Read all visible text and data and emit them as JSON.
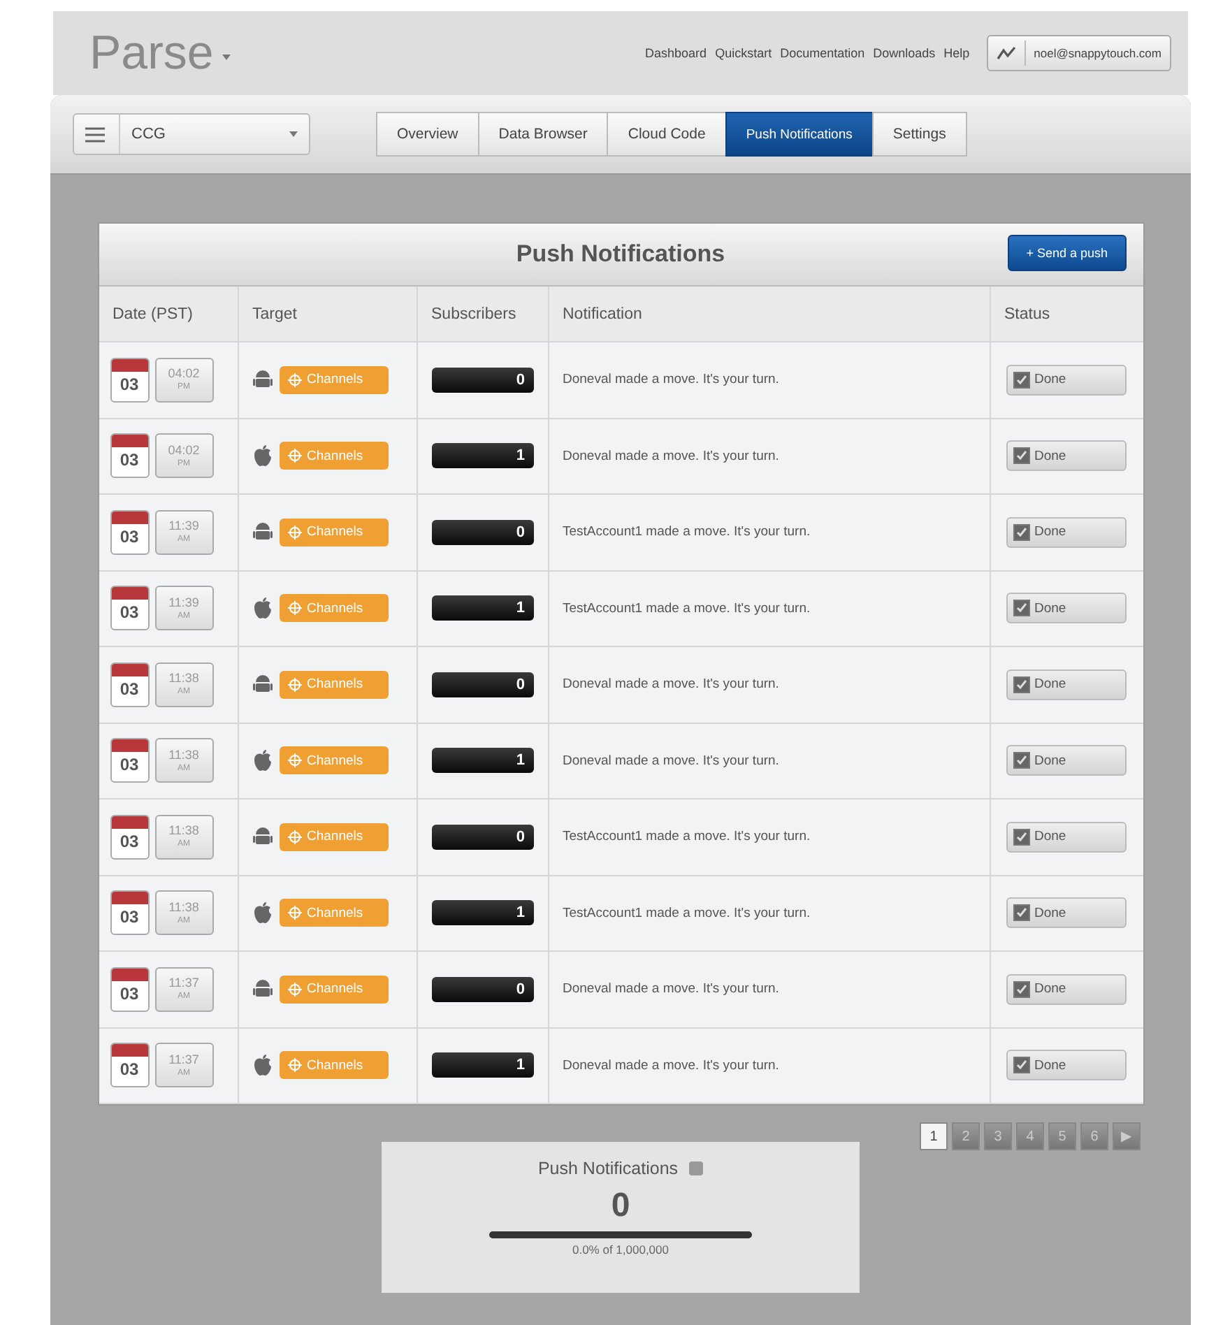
{
  "logo": "Parse",
  "top_links": [
    "Dashboard",
    "Quickstart",
    "Documentation",
    "Downloads",
    "Help"
  ],
  "account": {
    "email": "noel@snappytouch.com"
  },
  "app_select": {
    "value": "CCG"
  },
  "tabs": [
    {
      "label": "Overview",
      "selected": false
    },
    {
      "label": "Data Browser",
      "selected": false
    },
    {
      "label": "Cloud Code",
      "selected": false
    },
    {
      "label": "Push Notifications",
      "selected": true
    },
    {
      "label": "Settings",
      "selected": false
    }
  ],
  "panel": {
    "title": "Push Notifications",
    "send_button": "+ Send a push"
  },
  "table": {
    "columns": [
      "Date (PST)",
      "Target",
      "Subscribers",
      "Notification",
      "Status"
    ],
    "rows": [
      {
        "day": "03",
        "time": "04:02",
        "ampm": "PM",
        "kind": "android",
        "target": "Channels",
        "subscribers": "0",
        "notification": "Doneval made a move. It's your turn.",
        "status": "Done",
        "checked": true
      },
      {
        "day": "03",
        "time": "04:02",
        "ampm": "PM",
        "kind": "apple",
        "target": "Channels",
        "subscribers": "1",
        "notification": "Doneval made a move. It's your turn.",
        "status": "Done",
        "checked": true
      },
      {
        "day": "03",
        "time": "11:39",
        "ampm": "AM",
        "kind": "android",
        "target": "Channels",
        "subscribers": "0",
        "notification": "TestAccount1 made a move. It's your turn.",
        "status": "Done",
        "checked": true
      },
      {
        "day": "03",
        "time": "11:39",
        "ampm": "AM",
        "kind": "apple",
        "target": "Channels",
        "subscribers": "1",
        "notification": "TestAccount1 made a move. It's your turn.",
        "status": "Done",
        "checked": true
      },
      {
        "day": "03",
        "time": "11:38",
        "ampm": "AM",
        "kind": "android",
        "target": "Channels",
        "subscribers": "0",
        "notification": "Doneval made a move. It's your turn.",
        "status": "Done",
        "checked": true
      },
      {
        "day": "03",
        "time": "11:38",
        "ampm": "AM",
        "kind": "apple",
        "target": "Channels",
        "subscribers": "1",
        "notification": "Doneval made a move. It's your turn.",
        "status": "Done",
        "checked": true
      },
      {
        "day": "03",
        "time": "11:38",
        "ampm": "AM",
        "kind": "android",
        "target": "Channels",
        "subscribers": "0",
        "notification": "TestAccount1 made a move. It's your turn.",
        "status": "Done",
        "checked": true
      },
      {
        "day": "03",
        "time": "11:38",
        "ampm": "AM",
        "kind": "apple",
        "target": "Channels",
        "subscribers": "1",
        "notification": "TestAccount1 made a move. It's your turn.",
        "status": "Done",
        "checked": true
      },
      {
        "day": "03",
        "time": "11:37",
        "ampm": "AM",
        "kind": "android",
        "target": "Channels",
        "subscribers": "0",
        "notification": "Doneval made a move. It's your turn.",
        "status": "Done",
        "checked": true
      },
      {
        "day": "03",
        "time": "11:37",
        "ampm": "AM",
        "kind": "apple",
        "target": "Channels",
        "subscribers": "1",
        "notification": "Doneval made a move. It's your turn.",
        "status": "Done",
        "checked": true
      }
    ]
  },
  "pagination": {
    "pages": [
      {
        "label": "1",
        "selected": true
      },
      {
        "label": "2",
        "selected": false
      },
      {
        "label": "3",
        "selected": false
      },
      {
        "label": "4",
        "selected": false
      },
      {
        "label": "5",
        "selected": false
      },
      {
        "label": "6",
        "selected": false
      }
    ],
    "next": "▶"
  },
  "stats": {
    "title": "Push Notifications",
    "value": "0",
    "level": 0,
    "caption": "0.0% of 1,000,000"
  }
}
